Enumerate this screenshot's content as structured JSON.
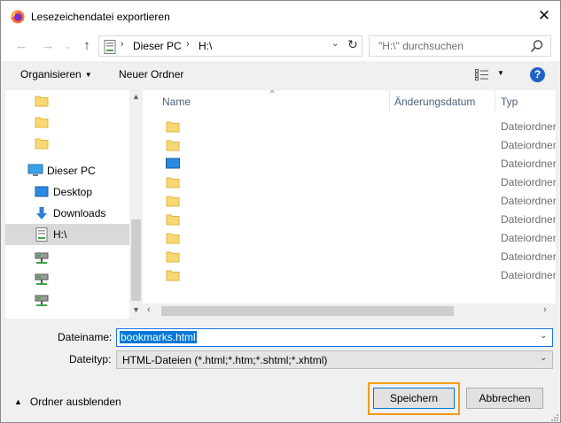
{
  "window": {
    "title": "Lesezeichendatei exportieren"
  },
  "nav": {
    "breadcrumbs": [
      "Dieser PC",
      "H:\\"
    ],
    "search_placeholder": "\"H:\\\" durchsuchen"
  },
  "toolbar": {
    "organize_label": "Organisieren",
    "new_folder_label": "Neuer Ordner",
    "help_label": "?"
  },
  "sidebar": {
    "items": [
      {
        "label": "",
        "icon": "folder-icon"
      },
      {
        "label": "",
        "icon": "folder-icon"
      },
      {
        "label": "",
        "icon": "folder-icon"
      },
      {
        "label": "Dieser PC",
        "icon": "computer-icon"
      },
      {
        "label": "Desktop",
        "icon": "desktop-icon"
      },
      {
        "label": "Downloads",
        "icon": "downloads-icon"
      },
      {
        "label": "H:\\",
        "icon": "drive-icon",
        "selected": true
      },
      {
        "label": "",
        "icon": "network-drive-icon"
      },
      {
        "label": "",
        "icon": "network-drive-icon"
      },
      {
        "label": "",
        "icon": "network-drive-icon"
      }
    ]
  },
  "file_list": {
    "columns": [
      "Name",
      "Änderungsdatum",
      "Typ"
    ],
    "rows": [
      {
        "icon": "folder-icon",
        "type": "Dateiordner"
      },
      {
        "icon": "folder-icon",
        "type": "Dateiordner"
      },
      {
        "icon": "desktop-folder-icon",
        "type": "Dateiordner"
      },
      {
        "icon": "folder-icon",
        "type": "Dateiordner"
      },
      {
        "icon": "folder-icon",
        "type": "Dateiordner"
      },
      {
        "icon": "folder-icon",
        "type": "Dateiordner"
      },
      {
        "icon": "folder-icon",
        "type": "Dateiordner"
      },
      {
        "icon": "folder-icon",
        "type": "Dateiordner"
      },
      {
        "icon": "folder-icon",
        "type": "Dateiordner"
      }
    ]
  },
  "form": {
    "filename_label": "Dateiname:",
    "filename_value": "bookmarks.html",
    "filetype_label": "Dateityp:",
    "filetype_value": "HTML-Dateien (*.html;*.htm;*.shtml;*.xhtml)"
  },
  "footer": {
    "hide_folders_label": "Ordner ausblenden",
    "save_label": "Speichern",
    "cancel_label": "Abbrechen"
  },
  "colors": {
    "accent": "#0078d7",
    "focus_highlight": "#f39c12",
    "folder": "#f8d775"
  }
}
